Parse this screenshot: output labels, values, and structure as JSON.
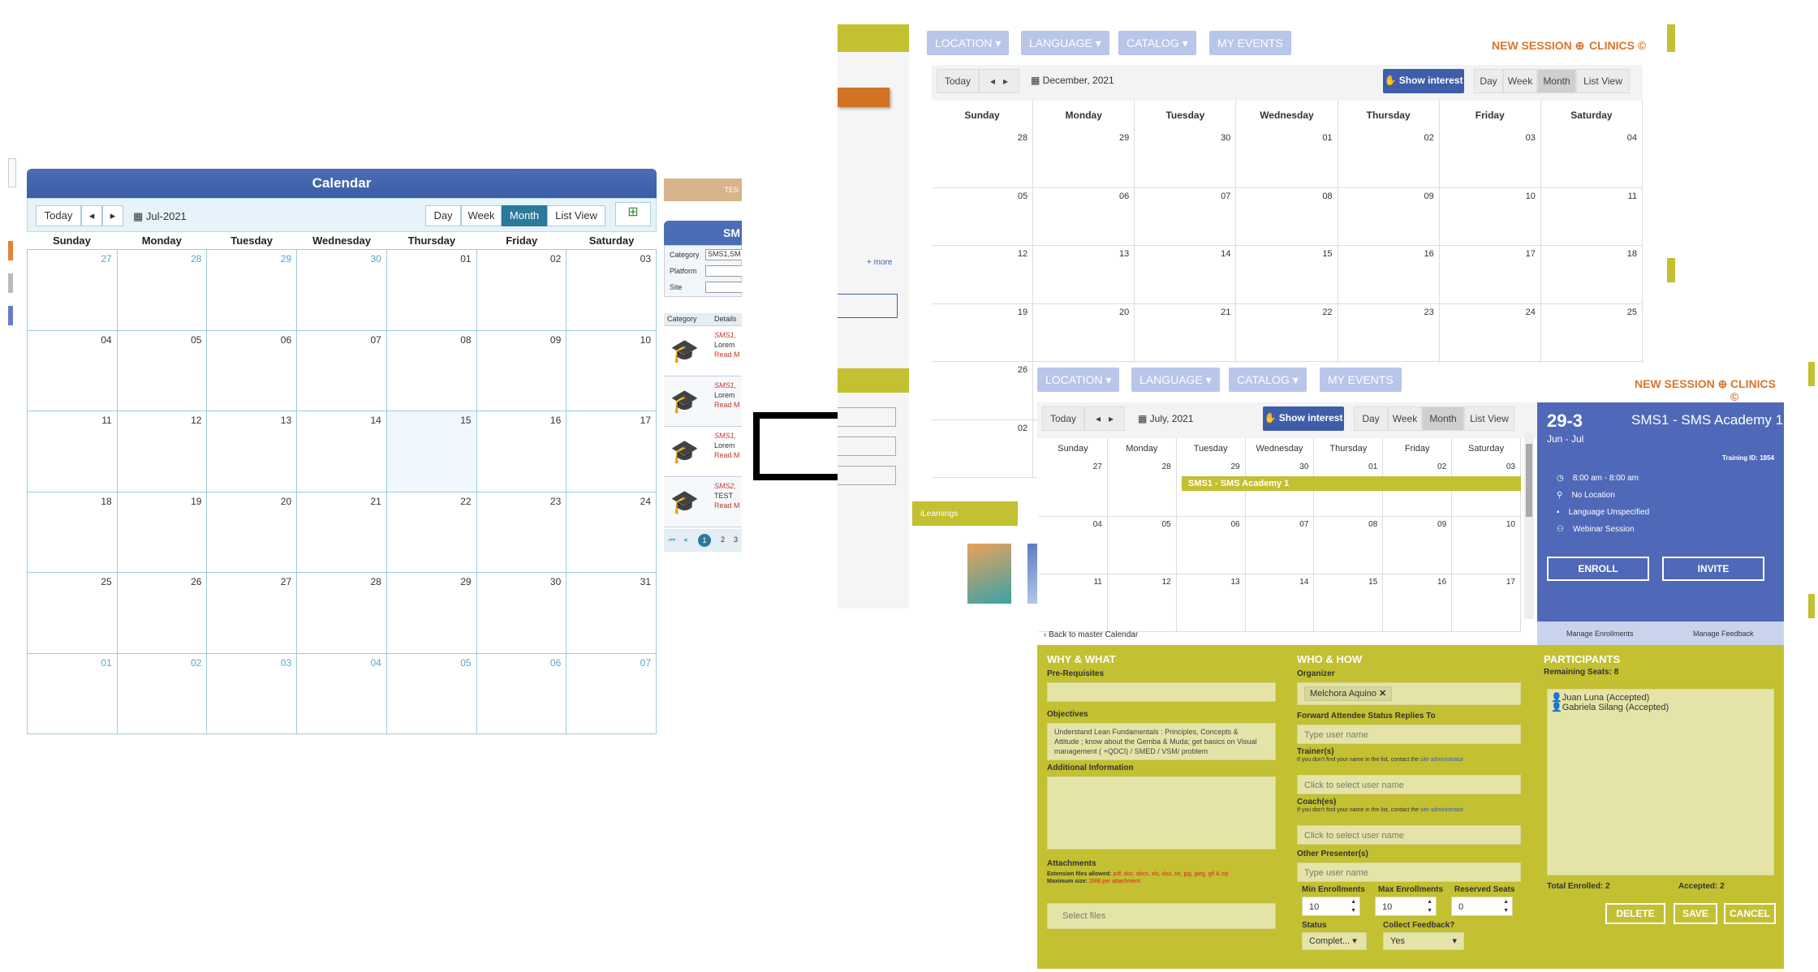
{
  "old_calendar": {
    "title": "Calendar",
    "today_label": "Today",
    "prev_label": "◂",
    "next_label": "▸",
    "date_label": "Jul-2021",
    "views": [
      "Day",
      "Week",
      "Month",
      "List View"
    ],
    "active_view": "Month",
    "weekdays": [
      "Sunday",
      "Monday",
      "Tuesday",
      "Wednesday",
      "Thursday",
      "Friday",
      "Saturday"
    ],
    "days": [
      "27",
      "28",
      "29",
      "30",
      "01",
      "02",
      "03",
      "04",
      "05",
      "06",
      "07",
      "08",
      "09",
      "10",
      "11",
      "12",
      "13",
      "14",
      "15",
      "16",
      "17",
      "18",
      "19",
      "20",
      "21",
      "22",
      "23",
      "24",
      "25",
      "26",
      "27",
      "28",
      "29",
      "30",
      "31",
      "01",
      "02",
      "03",
      "04",
      "05",
      "06",
      "07"
    ],
    "other_month_idx": [
      0,
      1,
      2,
      3,
      35,
      36,
      37,
      38,
      39,
      40,
      41
    ]
  },
  "old_panel": {
    "top_label": "TES",
    "header": "SM",
    "filters": [
      "Category",
      "Platform",
      "Site"
    ],
    "category_value": "SMS1,SM",
    "columns": [
      "Category",
      "Details"
    ],
    "rows": [
      {
        "cat": "SMS1,",
        "text": "Lorem",
        "link": "Read M"
      },
      {
        "cat": "SMS1,",
        "text": "Lorem",
        "link": "Read M"
      },
      {
        "cat": "SMS1,",
        "text": "Lorem",
        "link": "Read M"
      },
      {
        "cat": "SMS2,",
        "text": "TEST",
        "link": "Read M"
      }
    ],
    "pages": [
      "1",
      "2",
      "3"
    ]
  },
  "new_back": {
    "filters": [
      "LOCATION",
      "LANGUAGE",
      "CATALOG",
      "MY EVENTS"
    ],
    "new_session": "NEW SESSION",
    "clinics": "CLINICS",
    "today_label": "Today",
    "date_label": "December, 2021",
    "show_interest": "Show interest",
    "views": [
      "Day",
      "Week",
      "Month",
      "List View"
    ],
    "weekdays": [
      "Sunday",
      "Monday",
      "Tuesday",
      "Wednesday",
      "Thursday",
      "Friday",
      "Saturday"
    ],
    "days": [
      "28",
      "29",
      "30",
      "01",
      "02",
      "03",
      "04",
      "05",
      "06",
      "07",
      "08",
      "09",
      "10",
      "11",
      "12",
      "13",
      "14",
      "15",
      "16",
      "17",
      "18",
      "19",
      "20",
      "21",
      "22",
      "23",
      "24",
      "25",
      "26",
      "",
      "",
      "",
      "",
      "",
      "",
      "02",
      "",
      "",
      "",
      "",
      "",
      ""
    ],
    "more_label": "+ more",
    "ilearnings": "iLearnings"
  },
  "new_front": {
    "filters": [
      "LOCATION",
      "LANGUAGE",
      "CATALOG",
      "MY EVENTS"
    ],
    "new_session": "NEW SESSION",
    "clinics": "CLINICS",
    "today_label": "Today",
    "date_label": "July, 2021",
    "show_interest": "Show interest",
    "views": [
      "Day",
      "Week",
      "Month",
      "List View"
    ],
    "weekdays": [
      "Sunday",
      "Monday",
      "Tuesday",
      "Wednesday",
      "Thursday",
      "Friday",
      "Saturday"
    ],
    "days": [
      "27",
      "28",
      "29",
      "30",
      "01",
      "02",
      "03",
      "04",
      "05",
      "06",
      "07",
      "08",
      "09",
      "10",
      "11",
      "12",
      "13",
      "14",
      "15",
      "16",
      "17"
    ],
    "event_label": "SMS1 - SMS Academy 1",
    "back_link": "Back to master Calendar",
    "detail": {
      "date_range": "29-3",
      "months": "Jun - Jul",
      "title": "SMS1 - SMS Academy 1",
      "training_id": "Training ID: 1854",
      "time": "8:00 am - 8:00 am",
      "location": "No Location",
      "language": "Language Unspecified",
      "type": "Webinar Session",
      "enroll": "ENROLL",
      "invite": "INVITE",
      "manage_enrollments": "Manage Enrollments",
      "manage_feedback": "Manage Feedback"
    },
    "why_what": {
      "header": "WHY & WHAT",
      "prereq_label": "Pre-Requisites",
      "objectives_label": "Objectives",
      "objectives_text": "Understand Lean Fundamentals : Principles, Concepts & Attitude ; know about the Gemba & Muda; get basics on Visual management ( +QDCI) / SMED / VSM/ problem",
      "additional_label": "Additional Information",
      "attachments_label": "Attachments",
      "ext_label": "Extension files allowed:",
      "ext_value": "pdf, doc, docx, xls, xlsx, txt, jpg, jpeg, gif & zip",
      "max_label": "Maximum size:",
      "max_value": "2MB per attachment",
      "select_files": "Select files"
    },
    "who_how": {
      "header": "WHO & HOW",
      "organizer_label": "Organizer",
      "organizer_value": "Melchora Aquino",
      "forward_label": "Forward Attendee Status Replies To",
      "forward_placeholder": "Type user name",
      "trainer_label": "Trainer(s)",
      "hint": "If you don't find your name in the list, contact the",
      "hint_link": "site administrator",
      "trainer_placeholder": "Click to select user name",
      "coach_label": "Coach(es)",
      "coach_placeholder": "Click to select user name",
      "other_label": "Other Presenter(s)",
      "other_placeholder": "Type user name",
      "min_label": "Min Enrollments",
      "min_value": "10",
      "max_label": "Max Enrollments",
      "max_value": "10",
      "reserved_label": "Reserved Seats",
      "reserved_value": "0",
      "status_label": "Status",
      "status_value": "Complet...",
      "feedback_label": "Collect Feedback?",
      "feedback_value": "Yes"
    },
    "participants": {
      "header": "PARTICIPANTS",
      "remaining_label": "Remaining Seats:",
      "remaining_value": "8",
      "list": [
        "Juan Luna (Accepted)",
        "Gabriela Silang (Accepted)"
      ],
      "total_label": "Total Enrolled:",
      "total_value": "2",
      "accepted_label": "Accepted:",
      "accepted_value": "2",
      "delete": "DELETE",
      "save": "SAVE",
      "cancel": "CANCEL"
    }
  },
  "colors": {
    "blue": "#4f69b8",
    "olive": "#c3c032",
    "orange": "#d9762b",
    "light_blue": "#b7c6e9"
  }
}
